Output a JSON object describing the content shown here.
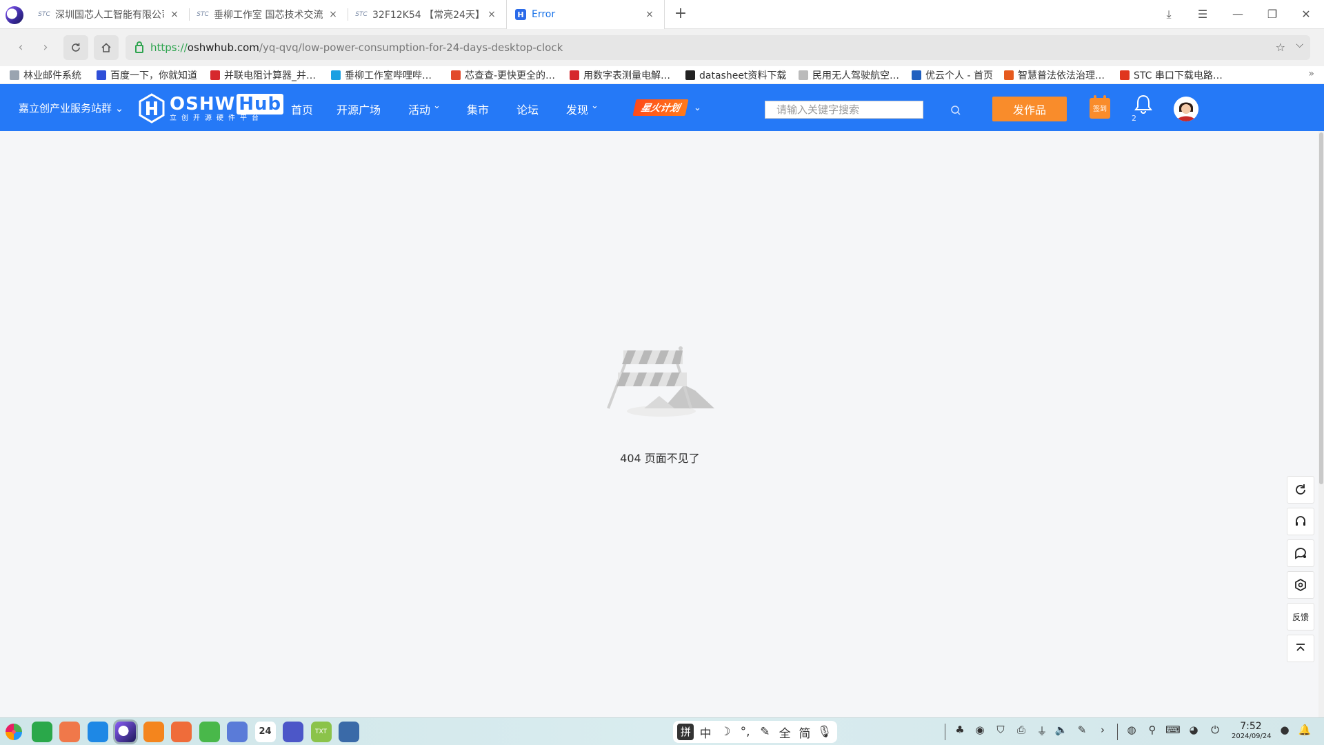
{
  "browser": {
    "tabs": [
      {
        "title": "深圳国芯人工智能有限公司",
        "favicon": "stc-icon",
        "active": false
      },
      {
        "title": "垂柳工作室 国芯技术交流",
        "favicon": "stc-icon",
        "active": false
      },
      {
        "title": "32F12K54 【常亮24天】",
        "favicon": "stc-icon",
        "active": false
      },
      {
        "title": "Error",
        "favicon": "oshwhub-icon",
        "active": true
      }
    ],
    "new_tab_label": "+",
    "close_glyph": "×",
    "window_controls": {
      "download": "⤓",
      "menu": "☰",
      "minimize": "—",
      "restore": "❐",
      "close": "✕"
    },
    "address": {
      "scheme": "https://",
      "host": "oshwhub.com",
      "path": "/yq-qvq/low-power-consumption-for-24-days-desktop-clock"
    },
    "bookmarks": [
      {
        "label": "林业邮件系统",
        "icon": "mail-icon",
        "color": "#9aa4b0"
      },
      {
        "label": "百度一下，你就知道",
        "icon": "baidu-icon",
        "color": "#2f4fd8"
      },
      {
        "label": "并联电阻计算器_并…",
        "icon": "calculator-icon",
        "color": "#d6282d"
      },
      {
        "label": "垂柳工作室哔哩哔…",
        "icon": "bilibili-icon",
        "color": "#1aa0e2"
      },
      {
        "label": "芯查查-更快更全的…",
        "icon": "xinchacha-icon",
        "color": "#e24a2a"
      },
      {
        "label": "用数字表测量电解…",
        "icon": "document-red-icon",
        "color": "#d6282d"
      },
      {
        "label": "datasheet资料下载",
        "icon": "datasheet-icon",
        "color": "#222222"
      },
      {
        "label": "民用无人驾驶航空…",
        "icon": "page-icon",
        "color": "#bbbbbb"
      },
      {
        "label": "优云个人 - 首页",
        "icon": "youyun-icon",
        "color": "#1f5fbf"
      },
      {
        "label": "智慧普法依法治理…",
        "icon": "law-icon",
        "color": "#e65a1e"
      },
      {
        "label": "STC 串口下载电路…",
        "icon": "csdn-icon",
        "color": "#e0361e"
      }
    ],
    "bookmarks_more": "»"
  },
  "site": {
    "site_switch_label": "嘉立创产业服务站群",
    "logo_main": "OSHW",
    "logo_hub": "Hub",
    "logo_sub": "立创开源硬件平台",
    "nav": [
      {
        "label": "首页",
        "dropdown": false
      },
      {
        "label": "开源广场",
        "dropdown": false
      },
      {
        "label": "活动",
        "dropdown": true
      },
      {
        "label": "集市",
        "dropdown": false
      },
      {
        "label": "论坛",
        "dropdown": false
      },
      {
        "label": "发现",
        "dropdown": true
      }
    ],
    "spark_label": "星火计划",
    "search_placeholder": "请输入关键字搜索",
    "publish_label": "发作品",
    "signin_label": "签到",
    "notification_count": "2",
    "brand_color": "#2579f7",
    "accent_color": "#f98c2b"
  },
  "main": {
    "error_message": "404 页面不见了"
  },
  "float_tools": [
    {
      "name": "refresh-icon",
      "glyph": "↻"
    },
    {
      "name": "headset-icon",
      "glyph": "☊"
    },
    {
      "name": "chat-icon",
      "glyph": "💬"
    },
    {
      "name": "settings-icon",
      "glyph": "⚙"
    },
    {
      "name": "feedback-label",
      "label": "反馈"
    },
    {
      "name": "back-to-top-icon",
      "glyph": "⤒"
    }
  ],
  "taskbar": {
    "apps": [
      {
        "name": "launcher-icon",
        "color": "#ffffff"
      },
      {
        "name": "terminal-icon",
        "color": "#2aa84a"
      },
      {
        "name": "app-store-icon",
        "color": "#f0784a"
      },
      {
        "name": "files-icon",
        "color": "#1e88e5"
      },
      {
        "name": "browser-icon",
        "color": "#3b2e86"
      },
      {
        "name": "package-icon",
        "color": "#f4851d"
      },
      {
        "name": "photos-icon",
        "color": "#ef6c3a"
      },
      {
        "name": "music-icon",
        "color": "#49b84a"
      },
      {
        "name": "document-icon",
        "color": "#5a7bd8"
      },
      {
        "name": "calendar-icon",
        "color": "#ffffff"
      },
      {
        "name": "system-settings-icon",
        "color": "#4c57c8"
      },
      {
        "name": "text-editor-icon",
        "color": "#8bc34a"
      },
      {
        "name": "screenshot-icon",
        "color": "#3a6aa8"
      }
    ],
    "calendar_day": "24",
    "text_editor_label": "TXT",
    "ime": [
      "拼",
      "中",
      "☽",
      "°,",
      "✎",
      "全",
      "简",
      "🎙"
    ],
    "tray_glyphs": [
      "♣",
      "◉",
      "⛉",
      "⎙",
      "⏚",
      "🔈",
      "✎",
      "›",
      "◍",
      "⚲",
      "⌨",
      "◕",
      "⏻",
      "●",
      "🔔"
    ],
    "time": "7:52",
    "date": "2024/09/24"
  }
}
